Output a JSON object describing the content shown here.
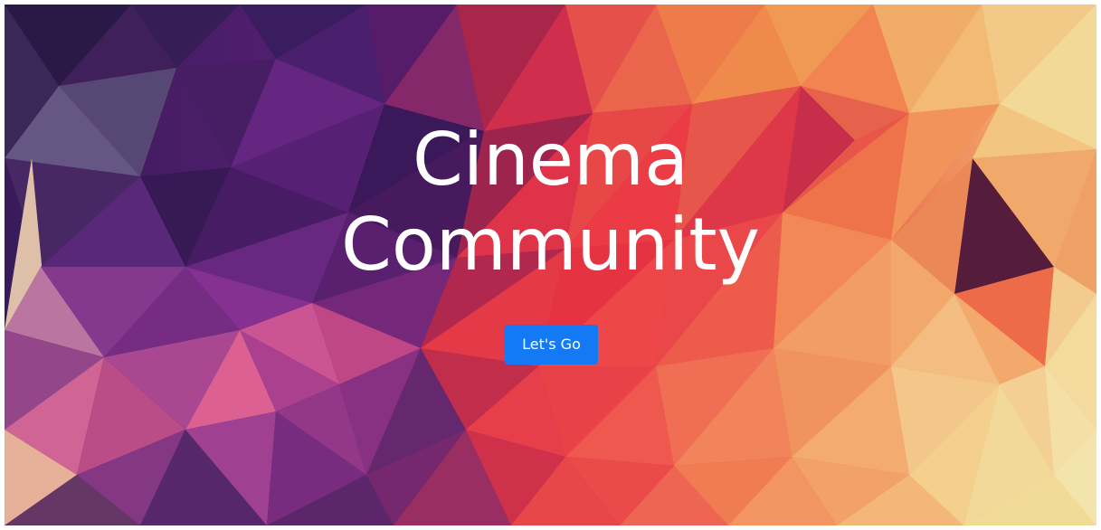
{
  "hero": {
    "title_line1": "Cinema",
    "title_line2": "Community",
    "button_label": "Let's Go",
    "button_color": "#1479f5"
  }
}
